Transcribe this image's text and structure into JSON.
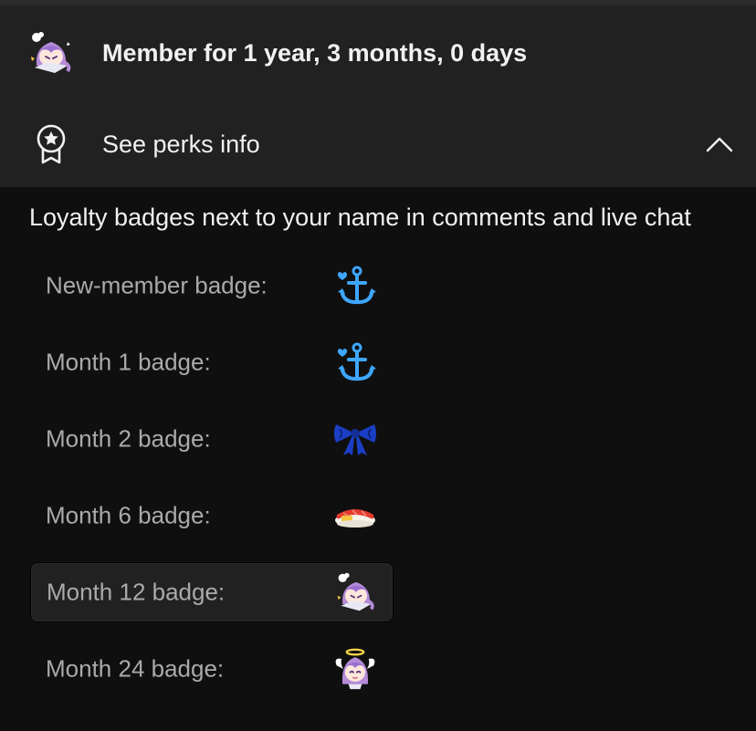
{
  "membership": {
    "duration_text": "Member for 1 year, 3 months, 0 days",
    "avatar_icon": "chibi-avatar-icon"
  },
  "perks": {
    "toggle_label": "See perks info",
    "icon": "award-ribbon-icon",
    "expanded": true,
    "chevron_icon": "chevron-up-icon"
  },
  "loyalty": {
    "heading": "Loyalty badges next to your name in comments and live chat",
    "badges": [
      {
        "label": "New-member badge:",
        "icon": "anchor-heart-icon"
      },
      {
        "label": "Month 1 badge:",
        "icon": "anchor-heart-icon"
      },
      {
        "label": "Month 2 badge:",
        "icon": "bow-ribbon-icon"
      },
      {
        "label": "Month 6 badge:",
        "icon": "sushi-icon"
      },
      {
        "label": "Month 12 badge:",
        "icon": "chibi-avatar-icon",
        "selected": true
      },
      {
        "label": "Month 24 badge:",
        "icon": "chibi-angel-icon"
      }
    ]
  },
  "colors": {
    "background": "#0f0f0f",
    "panel": "#212121",
    "text_primary": "#f1f1f1",
    "text_secondary": "#aaaaaa",
    "anchor_blue": "#3ea6ff",
    "bow_navy": "#1a3fc4",
    "hair_purple": "#b58bd9"
  }
}
